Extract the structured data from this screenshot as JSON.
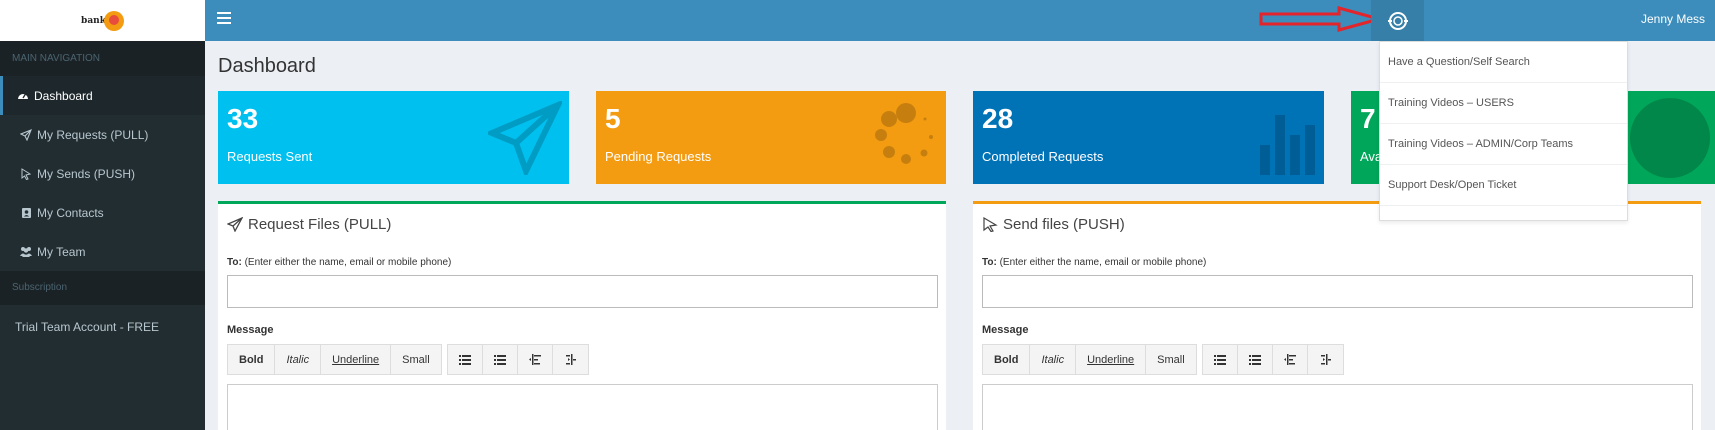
{
  "logo": {
    "text": "bank"
  },
  "header": {
    "user_name": "Jenny Mess"
  },
  "sidebar": {
    "header": "MAIN NAVIGATION",
    "items": [
      {
        "label": "Dashboard",
        "icon": "dashboard-icon"
      },
      {
        "label": "My Requests (PULL)",
        "icon": "paper-plane-icon"
      },
      {
        "label": "My Sends (PUSH)",
        "icon": "cursor-icon"
      },
      {
        "label": "My Contacts",
        "icon": "contact-card-icon"
      },
      {
        "label": "My Team",
        "icon": "users-icon"
      }
    ],
    "subscription_header": "Subscription",
    "subscription_item": "Trial Team Account - FREE"
  },
  "page": {
    "title": "Dashboard"
  },
  "stats": [
    {
      "value": "33",
      "label": "Requests Sent",
      "color": "#00c0ef"
    },
    {
      "value": "5",
      "label": "Pending Requests",
      "color": "#f39c12"
    },
    {
      "value": "28",
      "label": "Completed Requests",
      "color": "#0073b7"
    },
    {
      "value": "7",
      "label": "Ava",
      "color": "#00a65a"
    }
  ],
  "request_panel": {
    "title": "Request Files (PULL)",
    "to_label": "To:",
    "to_hint": "(Enter either the name, email or mobile phone)",
    "message_label": "Message",
    "border_color": "#00a65a"
  },
  "send_panel": {
    "title": "Send files (PUSH)",
    "to_label": "To:",
    "to_hint": "(Enter either the name, email or mobile phone)",
    "message_label": "Message",
    "border_color": "#f39c12"
  },
  "editor_toolbar": {
    "bold": "Bold",
    "italic": "Italic",
    "underline": "Underline",
    "small": "Small"
  },
  "help_menu": {
    "items": [
      "Have a Question/Self Search",
      "Training Videos – USERS",
      "Training Videos – ADMIN/Corp Teams",
      "Support Desk/Open Ticket"
    ]
  }
}
